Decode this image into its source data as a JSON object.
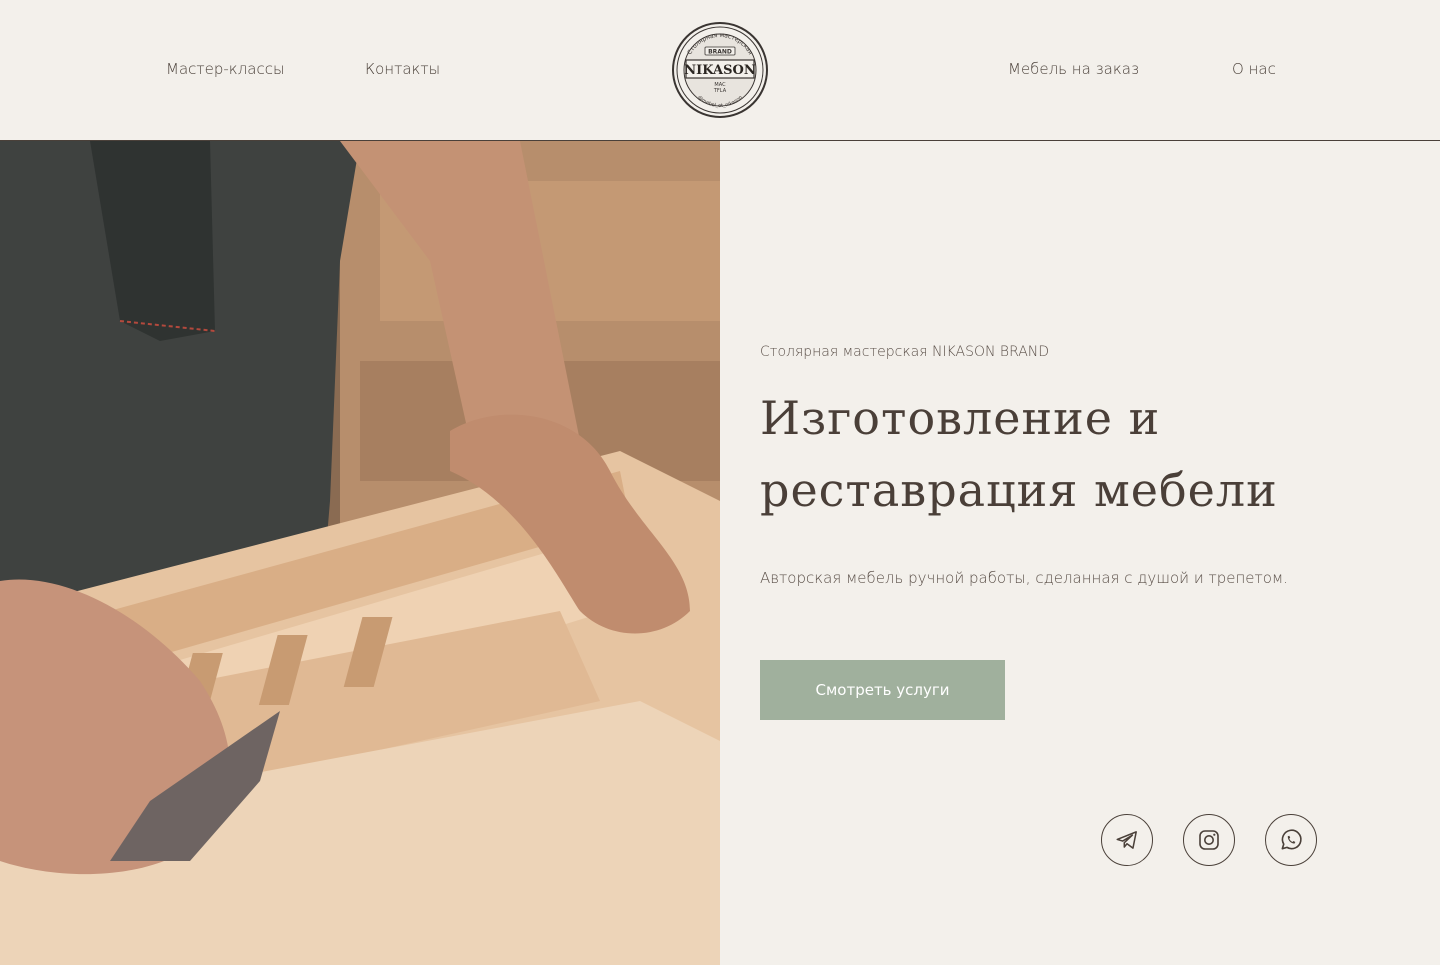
{
  "header": {
    "nav_left": [
      "Мастер-классы",
      "Контакты"
    ],
    "nav_right": [
      "Мебель на заказ",
      "О нас"
    ],
    "logo": {
      "name": "NIKASON",
      "top_text": "Столярная мастерская",
      "badge": "BRAND",
      "sub": "MAC",
      "sub2": "TFLA",
      "bottom_text": "@mebel_ot_nikason"
    }
  },
  "hero": {
    "eyebrow": "Столярная мастерская NIKASON BRAND",
    "headline": "Изготовление и реставрация мебели",
    "subtext": "Авторская мебель ручной работы, сделанная с душой и трепетом.",
    "cta_label": "Смотреть услуги"
  },
  "social": [
    "telegram-icon",
    "instagram-icon",
    "whatsapp-icon"
  ],
  "colors": {
    "background": "#f3f0eb",
    "text": "#4a4039",
    "accent_button": "#a0b09d"
  }
}
